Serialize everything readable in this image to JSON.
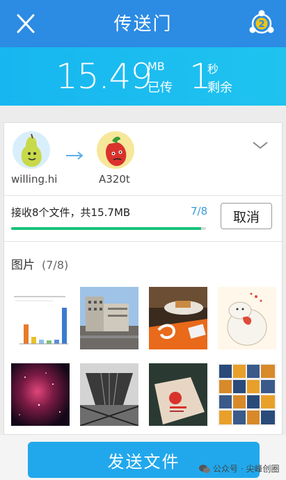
{
  "header": {
    "title": "传送门",
    "badge_number": "2",
    "close_icon": "close-icon",
    "badge_icon": "share-network-icon"
  },
  "stats": {
    "size_value": "15.49",
    "size_unit": "MB",
    "size_caption": "已传",
    "time_value": "1",
    "time_unit": "秒",
    "time_caption": "剩余"
  },
  "transfer": {
    "sender_name": "willing.hi",
    "receiver_name": "A320t",
    "status_text": "接收8个文件，共15.7MB",
    "progress_text": "7/8",
    "progress_fraction": 0.975,
    "cancel_label": "取消"
  },
  "gallery": {
    "section_title": "图片",
    "section_count": "(7/8)",
    "thumbnails": [
      "bar-chart-image",
      "building-image",
      "cake-image",
      "cartoon-image",
      "nebula-image",
      "bridge-image",
      "book-image",
      "city-night-image"
    ]
  },
  "footer": {
    "send_label": "发送文件",
    "watermark_text": "公众号 · 尖峰创圈"
  },
  "colors": {
    "title_bar": "#2c8be3",
    "stats_band": "#17b6f0",
    "progress": "#17c27a",
    "count_accent": "#3a9ad9",
    "send_button": "#21a8ec"
  }
}
